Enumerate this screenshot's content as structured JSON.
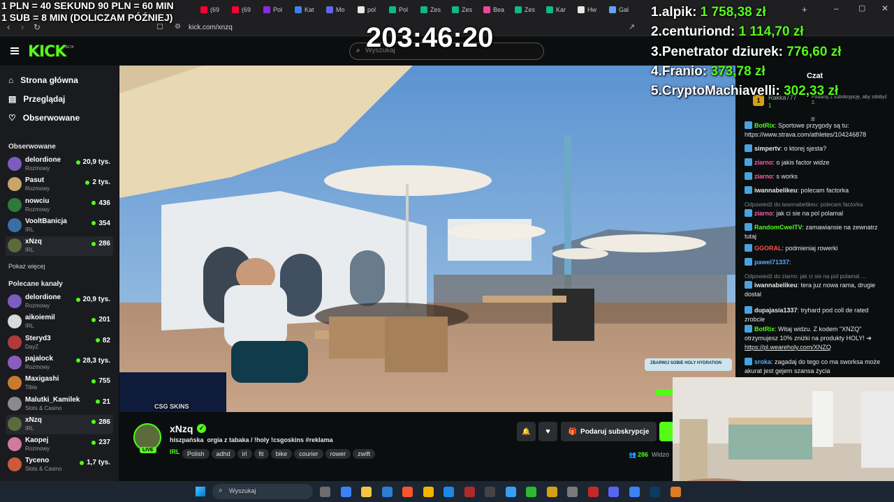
{
  "overlay": {
    "line1": "1 PLN = 40 SEKUND 90 PLN = 60 MIN",
    "line2": "1 SUB = 8 MIN (DOLICZAM PÓŹNIEJ)",
    "timer": "203:46:20",
    "leaderboard": [
      {
        "rank": "1.",
        "name": "alpik:",
        "amount": "1 758,38 zł"
      },
      {
        "rank": "2.",
        "name": "centuriond:",
        "amount": "1 114,70 zł"
      },
      {
        "rank": "3.",
        "name": "Penetrator dziurek:",
        "amount": "776,60 zł"
      },
      {
        "rank": "4.",
        "name": "Franio:",
        "amount": "373,78 zł"
      },
      {
        "rank": "5.",
        "name": "CryptoMachiavelli:",
        "amount": "302,33 zł"
      }
    ],
    "video_promo": "ZBARWIJ SOBIE HOLY HYDRATION",
    "video_logo": "CSG SKINS"
  },
  "browser": {
    "tabs": [
      {
        "label": "(69",
        "color": "#ff0033"
      },
      {
        "label": "(69",
        "color": "#ff0033"
      },
      {
        "label": "Pol",
        "color": "#8a2be2"
      },
      {
        "label": "Kat",
        "color": "#3b82f6"
      },
      {
        "label": "Mo",
        "color": "#6366f1"
      },
      {
        "label": "pol",
        "color": "#e8e8e8"
      },
      {
        "label": "Pol",
        "color": "#10b981"
      },
      {
        "label": "Zes",
        "color": "#10b981"
      },
      {
        "label": "Zes",
        "color": "#10b981"
      },
      {
        "label": "Bea",
        "color": "#ec4899"
      },
      {
        "label": "Zes",
        "color": "#10b981"
      },
      {
        "label": "Kar",
        "color": "#10b981"
      },
      {
        "label": "Hw",
        "color": "#e8e8e8"
      },
      {
        "label": "Gal",
        "color": "#60a5fa"
      }
    ],
    "url": "kick.com/xnzq"
  },
  "kick": {
    "logo": "KICK",
    "logo_badge": "BETA",
    "search_placeholder": "Wyszukaj",
    "nav": [
      {
        "label": "Strona główna",
        "icon": "home-icon"
      },
      {
        "label": "Przeglądaj",
        "icon": "browse-icon"
      },
      {
        "label": "Obserwowane",
        "icon": "heart-icon"
      }
    ],
    "followed_title": "Obserwowane",
    "followed": [
      {
        "name": "delordione",
        "category": "Rozmowy",
        "viewers": "20,9 tys.",
        "color": "#7c5cbf"
      },
      {
        "name": "Pasut",
        "category": "Rozmowy",
        "viewers": "2 tys.",
        "color": "#c9a46b"
      },
      {
        "name": "nowciu",
        "category": "Rozmowy",
        "viewers": "436",
        "color": "#2f7a3b"
      },
      {
        "name": "VooltBanicja",
        "category": "IRL",
        "viewers": "354",
        "color": "#3a6ea5"
      },
      {
        "name": "xNzq",
        "category": "IRL",
        "viewers": "286",
        "color": "#5b6b3c"
      }
    ],
    "show_more": "Pokaż więcej",
    "recommended_title": "Polecane kanały",
    "recommended": [
      {
        "name": "delordione",
        "category": "Rozmowy",
        "viewers": "20,9 tys.",
        "color": "#7c5cbf"
      },
      {
        "name": "aikoiemil",
        "category": "IRL",
        "viewers": "201",
        "color": "#d9d9d9"
      },
      {
        "name": "Steryd3",
        "category": "DayZ",
        "viewers": "82",
        "color": "#b23a3a"
      },
      {
        "name": "pajalock",
        "category": "Rozmowy",
        "viewers": "28,3 tys.",
        "color": "#8a5cbf"
      },
      {
        "name": "Maxigashi",
        "category": "Tibia",
        "viewers": "755",
        "color": "#c97a2f"
      },
      {
        "name": "Malutki_Kamilek",
        "category": "Slots & Casino",
        "viewers": "21",
        "color": "#8a8a8a"
      },
      {
        "name": "xNzq",
        "category": "IRL",
        "viewers": "286",
        "color": "#5b6b3c"
      },
      {
        "name": "Kaopej",
        "category": "Rozmowy",
        "viewers": "237",
        "color": "#d07aa0"
      },
      {
        "name": "Tyceno",
        "category": "Slots & Casino",
        "viewers": "1,7 tys.",
        "color": "#c95a3a"
      }
    ]
  },
  "stream": {
    "channel": "xNzq",
    "live_badge": "LIVE",
    "title": "hiszpańska  orgia z tabaka / !holy !csgoskins #reklama",
    "category": "IRL",
    "tags": [
      "Polish",
      "adhd",
      "irl",
      "fit",
      "bike",
      "courier",
      "rower",
      "zwift"
    ],
    "subscribe_label": "Podaruj subskrypcje",
    "viewers": "286",
    "viewers_label": "Widzó"
  },
  "chat": {
    "title": "Czat",
    "pinned_user": "Rakka777",
    "pinned_count": "1",
    "gift_text": "Podaruj 1 subskrypcję, aby zdobyć 2.",
    "messages": [
      {
        "user": "BotRix",
        "color": "#53fc18",
        "text": "Sportowe przygody są tu: https://www.strava.com/athletes/104246878"
      },
      {
        "user": "simpertv",
        "color": "#e8e8e8",
        "text": "o ktorej sjesta?"
      },
      {
        "user": "ziarno",
        "color": "#ff5ca8",
        "text": "o jakis factor widze"
      },
      {
        "user": "ziarno",
        "color": "#ff5ca8",
        "text": "s works"
      },
      {
        "user": "iwannabelikeu",
        "color": "#e8e8e8",
        "text": "polecam factorka"
      },
      {
        "user": "ziarno",
        "color": "#ff5ca8",
        "text": "jak ci sie na pol polamal",
        "reply": "Odpowiedź do iwannabelikeu: polecam factorka"
      },
      {
        "user": "RandomCwelTV",
        "color": "#53fc18",
        "text": "zamawiansie na zewnatrz tutaj"
      },
      {
        "user": "GGORAL",
        "color": "#ff4d4d",
        "text": "podmieniaj rowerki"
      },
      {
        "user": "pawel71337",
        "color": "#5ca8ff",
        "text": ""
      },
      {
        "user": "iwannabelikeu",
        "color": "#e8e8e8",
        "text": "tera juz nowa rama, drugie dostal",
        "reply": "Odpowiedź do ziarno: jak ci sie na pol polamal ..."
      },
      {
        "user": "dupajasia1337",
        "color": "#e8e8e8",
        "text": "tryhard pod coll de rated zrobcie"
      },
      {
        "user": "BotRix",
        "color": "#53fc18",
        "text": "Witaj widzu. Z kodem \"XNZQ\" otrzymujesz 10% zniżki na produkty HOLY! ➔",
        "link": "https://pl.weareholy.com/XNZQ"
      },
      {
        "user": "sroka",
        "color": "#5ca8ff",
        "text": "zagadaj do tego co ma sworksa może akurat jest gejem szansa życia"
      }
    ]
  },
  "taskbar": {
    "search_placeholder": "Wyszukaj"
  },
  "colors": {
    "kick_green": "#53fc18",
    "bg": "#0b0e0f",
    "sidebar": "#191b1f"
  }
}
